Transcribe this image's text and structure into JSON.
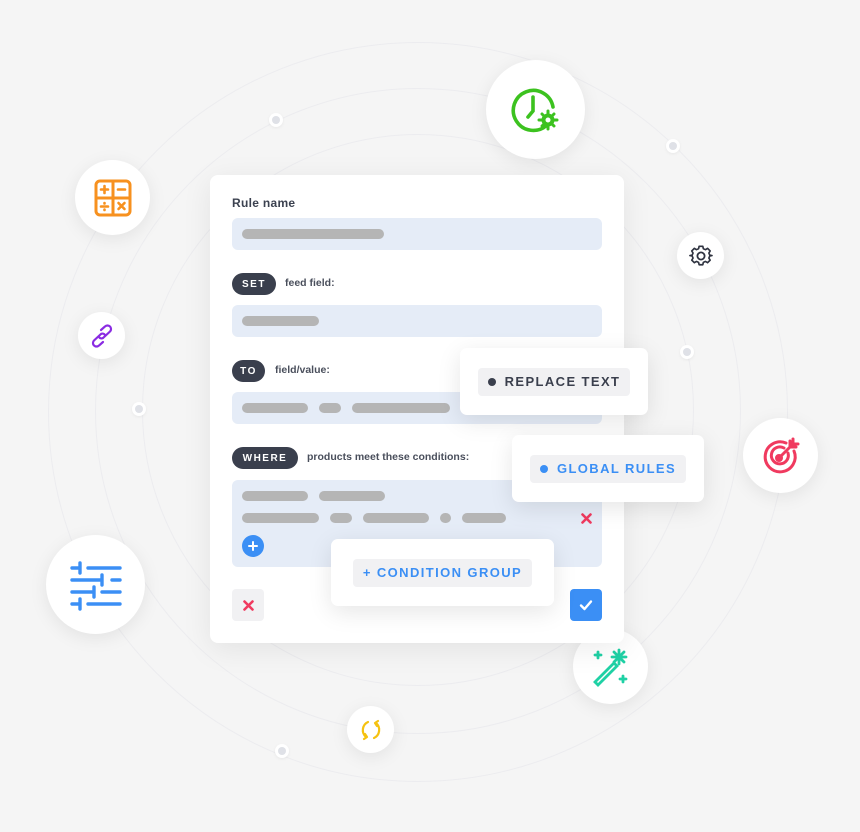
{
  "form": {
    "rule_name_label": "Rule name",
    "set_keyword": "SET",
    "set_hint": "feed field:",
    "to_keyword": "TO",
    "to_hint": "field/value:",
    "where_keyword": "WHERE",
    "where_hint": "products meet these conditions:"
  },
  "popups": {
    "replace_text": "REPLACE TEXT",
    "global_rules": "GLOBAL RULES",
    "condition_group": "+ CONDITION GROUP"
  },
  "icons": [
    {
      "name": "clock-gear-icon",
      "color": "#3cc21f"
    },
    {
      "name": "calculator-icon",
      "color": "#f7911f"
    },
    {
      "name": "link-icon",
      "color": "#8a2be2"
    },
    {
      "name": "sliders-icon",
      "color": "#3b8ff5"
    },
    {
      "name": "gear-icon",
      "color": "#2f3340"
    },
    {
      "name": "target-icon",
      "color": "#f03a5f"
    },
    {
      "name": "magic-wand-icon",
      "color": "#1fd1a5"
    },
    {
      "name": "sync-icon",
      "color": "#f5c211"
    }
  ],
  "colors": {
    "accent_blue": "#3b8ff5",
    "danger_red": "#f03a5f",
    "dark_pill": "#3a3f4d",
    "field_bg": "#e5ecf7"
  }
}
